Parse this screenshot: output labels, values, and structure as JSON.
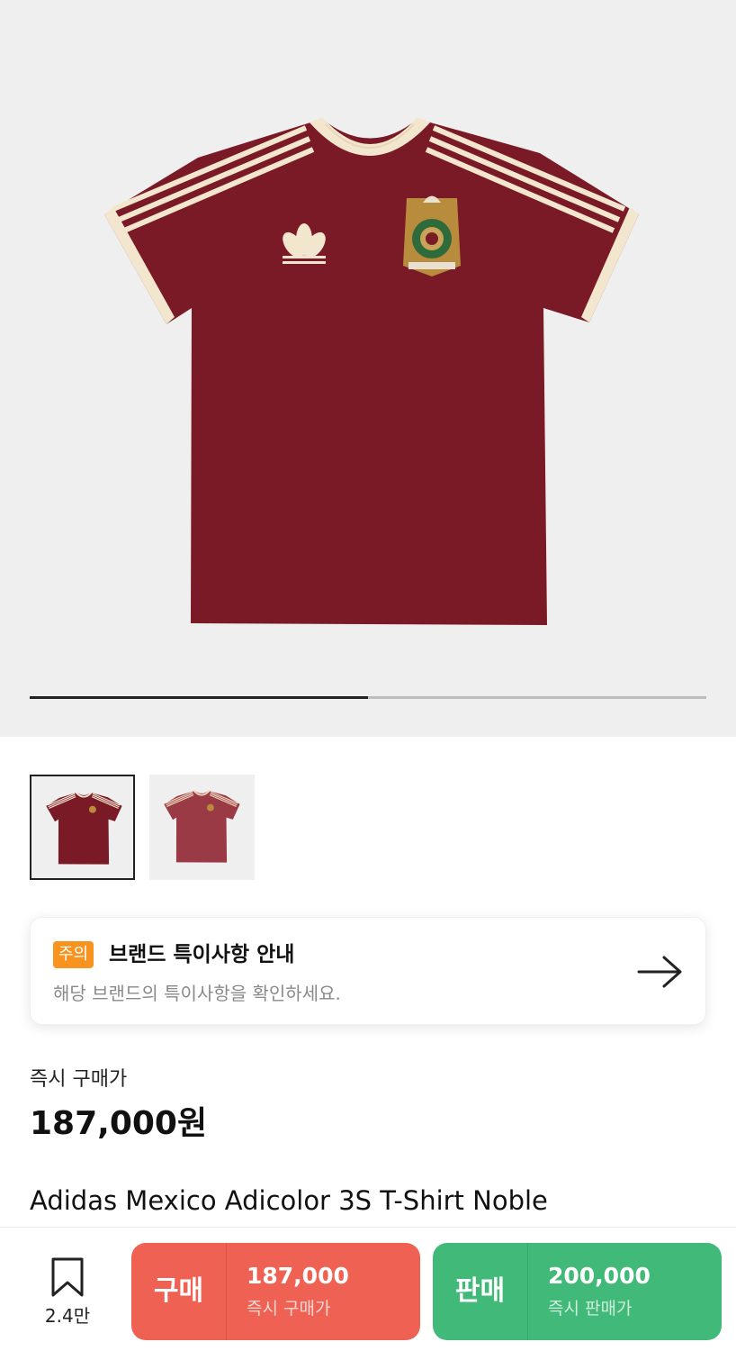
{
  "hero": {
    "image_alt": "Adidas Mexico Adicolor 3S T-Shirt Noble",
    "carousel_progress": 0.5,
    "colors": {
      "shirt": "#7a1a26",
      "trim": "#f3e6cf",
      "background": "#efefef"
    }
  },
  "thumbnails": [
    {
      "active": true
    },
    {
      "active": false
    }
  ],
  "notice": {
    "badge": "주의",
    "title": "브랜드 특이사항 안내",
    "subtitle": "해당 브랜드의 특이사항을 확인하세요.",
    "icon": "arrow-right-icon",
    "badge_color": "#f7931e"
  },
  "price": {
    "label": "즉시 구매가",
    "value": "187,000원"
  },
  "product": {
    "name": "Adidas Mexico Adicolor 3S T-Shirt Noble"
  },
  "bottom_bar": {
    "bookmark": {
      "icon": "bookmark-icon",
      "count": "2.4만"
    },
    "buy": {
      "label": "구매",
      "price": "187,000",
      "sub": "즉시 구매가",
      "color": "#ef6253"
    },
    "sell": {
      "label": "판매",
      "price": "200,000",
      "sub": "즉시 판매가",
      "color": "#41b979"
    }
  }
}
